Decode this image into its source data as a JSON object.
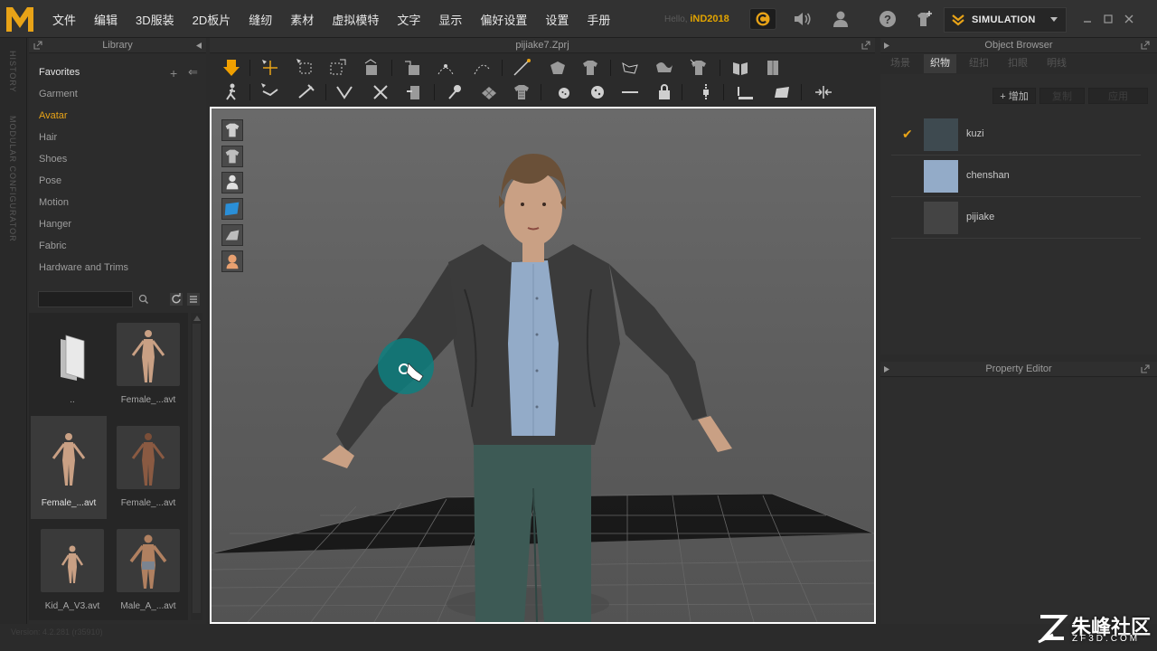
{
  "menubar": {
    "menus": [
      "文件",
      "编辑",
      "3D服装",
      "2D板片",
      "缝纫",
      "素材",
      "虚拟模特",
      "文字",
      "显示",
      "偏好设置",
      "设置",
      "手册"
    ],
    "hello_prefix": "Hello,",
    "username": "iND2018",
    "simulation_label": "SIMULATION"
  },
  "sidetabs": [
    "HISTORY",
    "MODULAR CONFIGURATOR"
  ],
  "library": {
    "title": "Library",
    "favorites_label": "Favorites",
    "items": [
      "Garment",
      "Avatar",
      "Hair",
      "Shoes",
      "Pose",
      "Motion",
      "Hanger",
      "Fabric",
      "Hardware and Trims"
    ],
    "active_item": "Avatar",
    "search_value": "",
    "thumbnails": [
      {
        "name": "..",
        "kind": "folder"
      },
      {
        "name": "Female_...avt",
        "kind": "avatar"
      },
      {
        "name": "Female_...avt",
        "kind": "avatar"
      },
      {
        "name": "Female_...avt",
        "kind": "avatar"
      },
      {
        "name": "Kid_A_V3.avt",
        "kind": "avatar"
      },
      {
        "name": "Male_A_...avt",
        "kind": "avatar"
      }
    ],
    "selected_thumbnail": "Female_...avt"
  },
  "viewport": {
    "file_title": "pijiake7.Zprj"
  },
  "object_browser": {
    "title": "Object Browser",
    "tabs": [
      "场景",
      "织物",
      "纽扣",
      "扣眼",
      "明线"
    ],
    "active_tab": "织物",
    "buttons": {
      "add": "+ 增加",
      "copy": "复制",
      "apply": "应用"
    },
    "fabrics": [
      {
        "name": "kuzi",
        "color": "#3e4a50",
        "checked": true
      },
      {
        "name": "chenshan",
        "color": "#93abc8",
        "checked": false
      },
      {
        "name": "pijiake",
        "color": "#444444",
        "checked": false
      }
    ]
  },
  "property_editor": {
    "title": "Property Editor"
  },
  "status": {
    "version": "Version: 4.2.281 (r35910)"
  },
  "watermark": {
    "text": "朱峰社区",
    "sub": "ZF3D.COM"
  },
  "colors": {
    "accent": "#e8a317",
    "background": "#2b2b2b",
    "viewport_border": "#ffffff"
  }
}
